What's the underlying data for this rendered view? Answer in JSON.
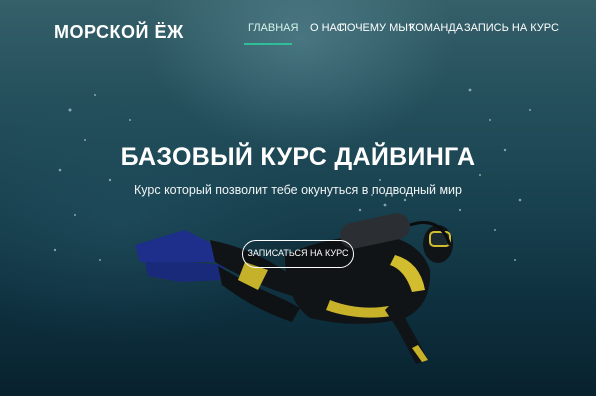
{
  "site": {
    "logo": "МОРСКОЙ ЁЖ"
  },
  "nav": {
    "items": [
      {
        "label": "ГЛАВНАЯ",
        "active": true
      },
      {
        "label": "О НАС",
        "active": false
      },
      {
        "label": "ПОЧЕМУ МЫ?",
        "active": false
      },
      {
        "label": "КОМАНДА",
        "active": false
      },
      {
        "label": "ЗАПИСЬ НА КУРС",
        "active": false
      }
    ]
  },
  "hero": {
    "title": "БАЗОВЫЙ КУРС ДАЙВИНГА",
    "subtitle": "Курс который позволит тебе окунуться в подводный мир",
    "cta_label": "ЗАПИСАТЬСЯ НА КУРС"
  },
  "colors": {
    "accent": "#2fbf98",
    "water_dark": "#0d2e3c",
    "water_light": "#35606a",
    "text": "#ffffff"
  }
}
